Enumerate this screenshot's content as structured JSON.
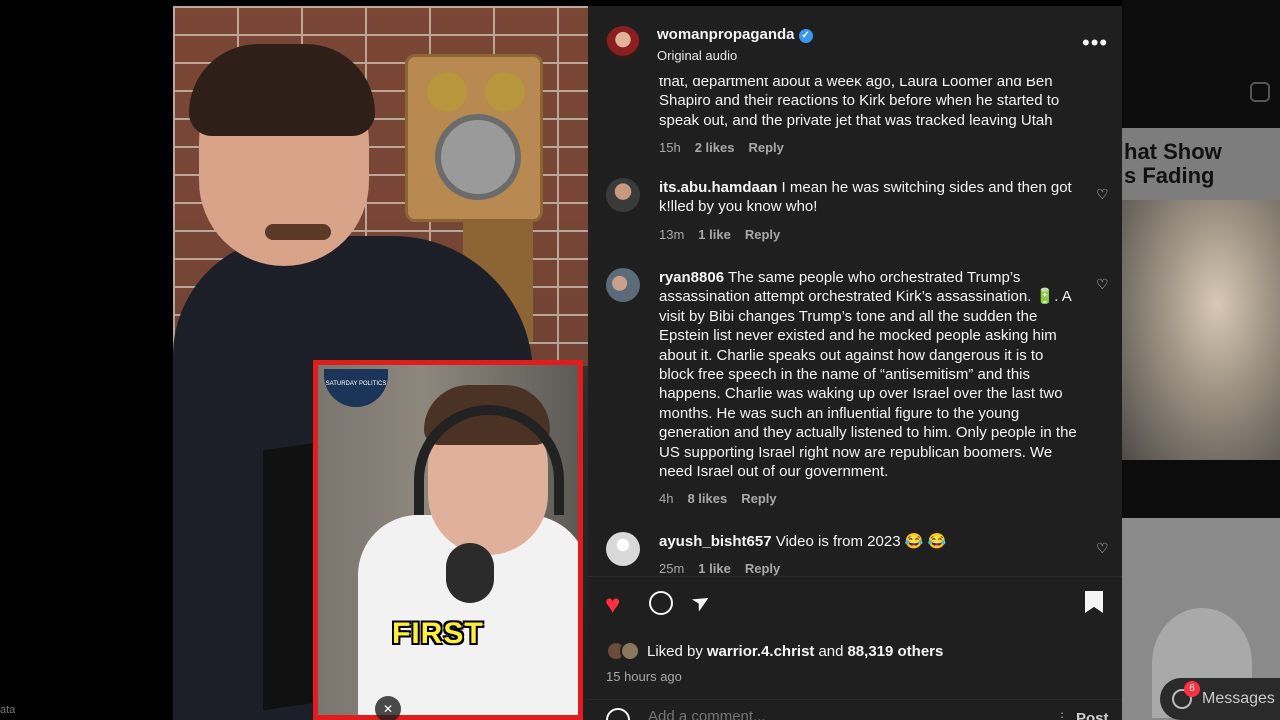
{
  "post": {
    "username": "womanpropaganda",
    "audio": "Original audio"
  },
  "video": {
    "caption": "FIRST",
    "inset_logo": "SATURDAY POLITICS"
  },
  "comments": [
    {
      "username": "",
      "text": "that, department about a week ago, Laura Loomer and Ben Shapiro and their reactions to Kirk before when he started to speak out, and the private jet that was tracked leaving Utah",
      "time": "15h",
      "likes": "2 likes",
      "reply": "Reply"
    },
    {
      "username": "its.abu.hamdaan",
      "text": "I mean he was switching sides and then got k!lled by you know who!",
      "time": "13m",
      "likes": "1 like",
      "reply": "Reply"
    },
    {
      "username": "ryan8806",
      "text": "The same people who orchestrated Trump’s assassination attempt orchestrated Kirk’s assassination. 🔋. A visit by Bibi changes Trump’s tone and all the sudden the Epstein list never existed and he mocked people asking him about it. Charlie speaks out against how dangerous it is to block free speech in the name of “antisemitism” and this happens. Charlie was waking up over Israel over the last two months. He was such an influential figure to the young generation and they actually listened to him. Only people in the US supporting Israel right now are republican boomers. We need Israel out of our government.",
      "time": "4h",
      "likes": "8 likes",
      "reply": "Reply"
    },
    {
      "username": "ayush_bisht657",
      "text": "Video is from 2023 😂 😂",
      "time": "25m",
      "likes": "1 like",
      "reply": "Reply"
    }
  ],
  "likes_summary": {
    "prefix": "Liked by",
    "user": "warrior.4.christ",
    "conjunction": "and",
    "count": "88,319 others"
  },
  "posted_ago": "15 hours ago",
  "add_comment": {
    "placeholder": "Add a comment...",
    "post_label": "Post"
  },
  "background": {
    "card_title": "hat Show\ns Fading",
    "messages_label": "Messages",
    "messages_badge": "6",
    "corner_text": "ata"
  },
  "colors": {
    "panel_bg": "#1f1f1f",
    "like_red": "#ff3040",
    "verified_blue": "#3897f0",
    "inset_border": "#e01c1c",
    "caption_yellow": "#ffef3a"
  },
  "icons": [
    "verified-badge-icon",
    "more-options-icon",
    "heart-icon",
    "comment-icon",
    "share-icon",
    "bookmark-icon",
    "emoji-icon",
    "mute-icon"
  ]
}
